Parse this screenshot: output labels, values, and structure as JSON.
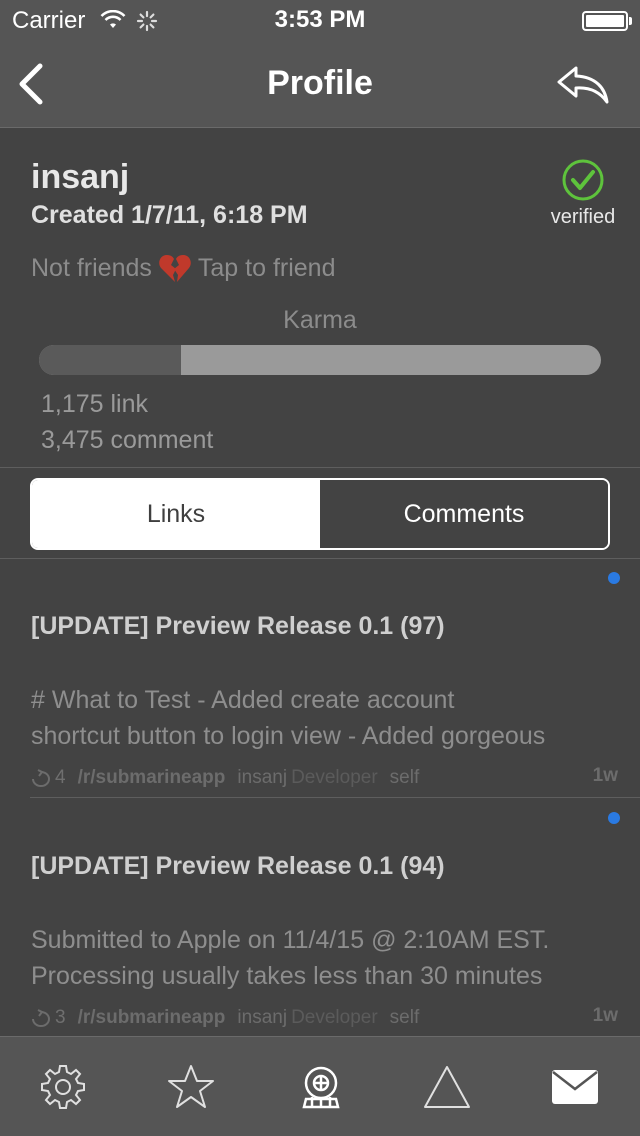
{
  "status_bar": {
    "carrier": "Carrier",
    "time": "3:53 PM"
  },
  "nav": {
    "title": "Profile",
    "back_icon": "chevron-left-icon",
    "share_icon": "reply-arrow-icon"
  },
  "profile": {
    "username": "insanj",
    "created": "Created 1/7/11, 6:18 PM",
    "verified_label": "verified",
    "friend_status": "Not friends",
    "friend_action": "Tap to friend",
    "karma_label": "Karma",
    "karma_link": "1,175 link",
    "karma_comment": "3,475 comment",
    "karma_link_fraction": 0.253
  },
  "tabs": {
    "links": "Links",
    "comments": "Comments",
    "selected": "links"
  },
  "posts": [
    {
      "title": "[UPDATE] Preview Release 0.1 (97)",
      "body_line1": "# What to Test - Added create account",
      "body_line2": "shortcut button to login view - Added gorgeous",
      "score": "4",
      "subreddit": "/r/submarineapp",
      "author": "insanj",
      "flair": "Developer",
      "domain": "self",
      "age": "1w",
      "unread": true
    },
    {
      "title": "[UPDATE] Preview Release 0.1 (94)",
      "body_line1": "Submitted to Apple on 11/4/15 @ 2:10AM EST.",
      "body_line2": "Processing usually takes less than 30 minutes",
      "score": "3",
      "subreddit": "/r/submarineapp",
      "author": "insanj",
      "flair": "Developer",
      "domain": "self",
      "age": "1w",
      "unread": true
    }
  ],
  "tab_bar": {
    "items": [
      "gear-icon",
      "star-icon",
      "diving-helmet-icon",
      "triangle-icon",
      "envelope-icon"
    ]
  },
  "colors": {
    "background": "#434343",
    "bars": "#555555",
    "verified_green": "#5ec33c",
    "unread_blue": "#2a7ae2",
    "heart_red": "#c0392b"
  }
}
